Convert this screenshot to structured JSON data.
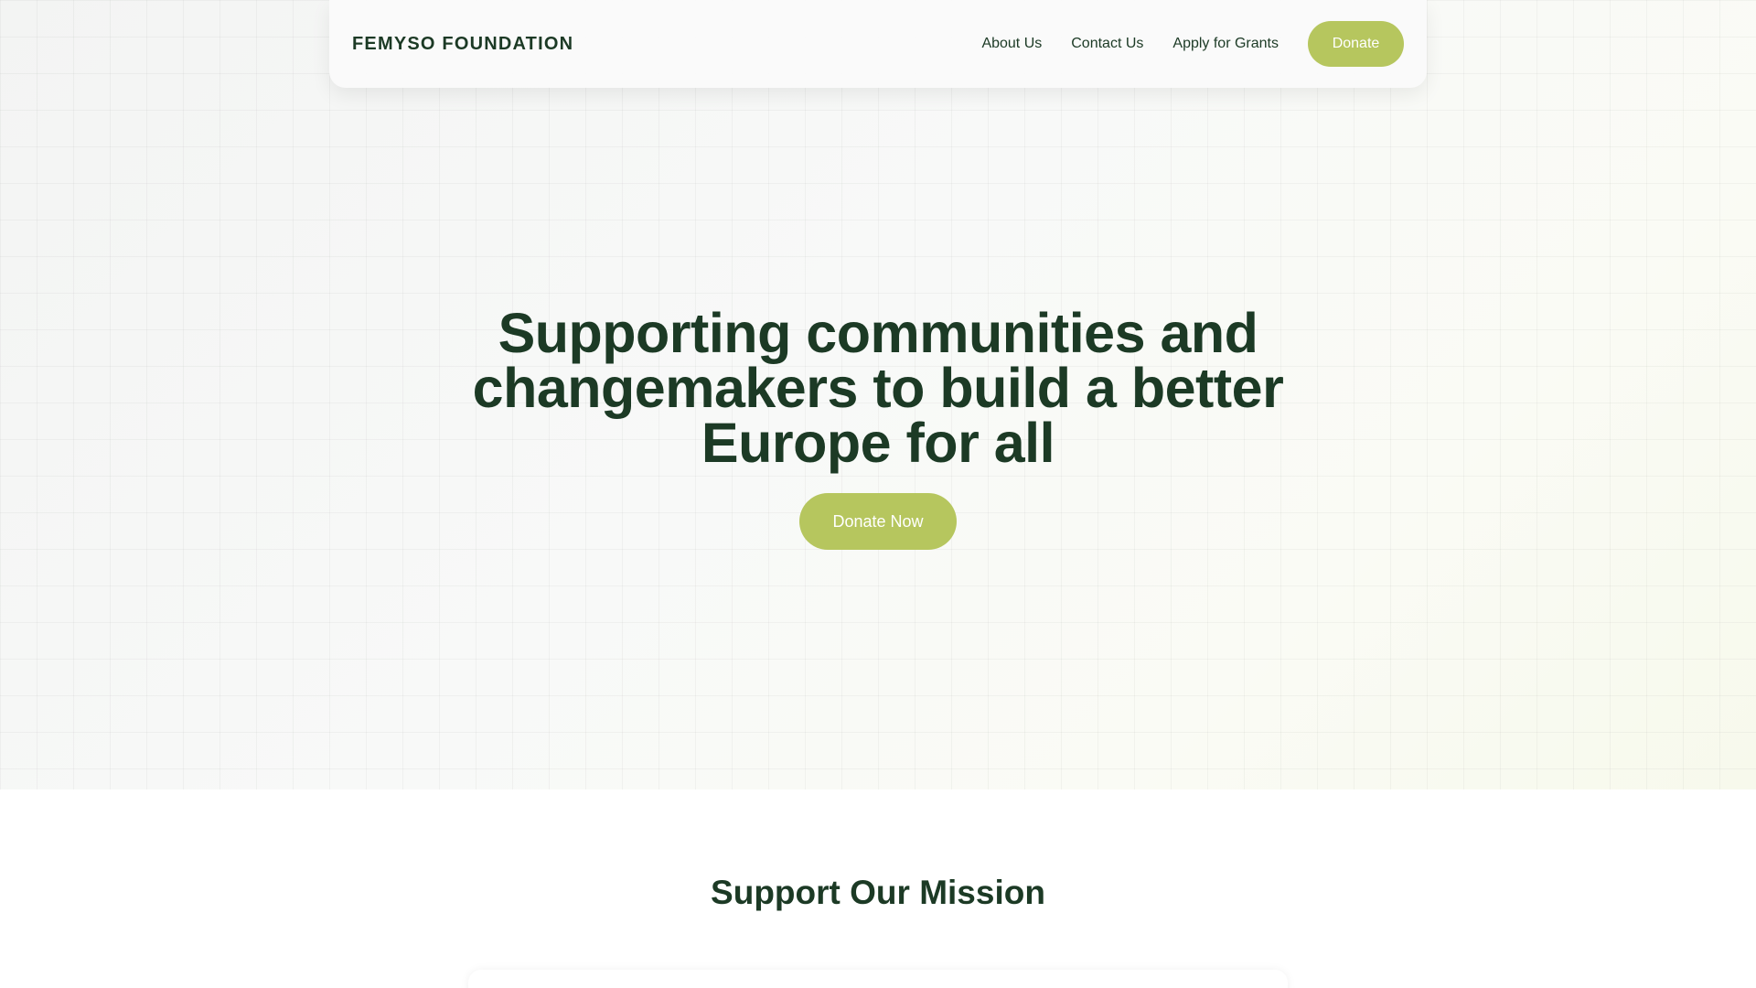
{
  "navbar": {
    "brand": "FEMYSO FOUNDATION",
    "links": [
      {
        "label": "About Us"
      },
      {
        "label": "Contact Us"
      },
      {
        "label": "Apply for Grants"
      }
    ],
    "donate_label": "Donate"
  },
  "hero": {
    "headline": "Supporting communities and changemakers to build a better Europe for all",
    "cta_label": "Donate Now"
  },
  "mission": {
    "title": "Support Our Mission"
  },
  "colors": {
    "brand_green": "#1c3a25",
    "accent_lime": "#b6c65e"
  }
}
